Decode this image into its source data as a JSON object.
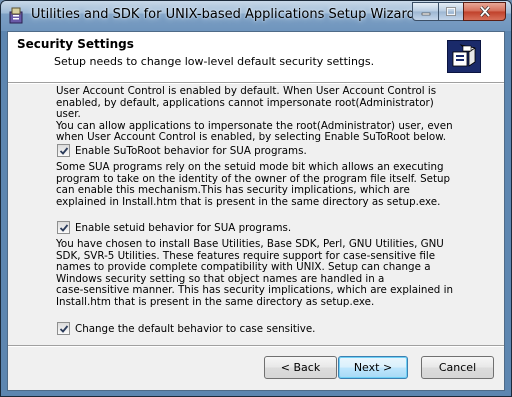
{
  "window": {
    "title": "Utilities and SDK for UNIX-based Applications Setup Wizard",
    "minimize_icon": "minimize-icon",
    "maximize_icon": "maximize-icon",
    "close_icon": "close-icon"
  },
  "header": {
    "title": "Security Settings",
    "subtitle": "Setup needs to change low-level default security settings.",
    "icon": "security-settings-icon"
  },
  "body": {
    "intro": "User Account Control is enabled by default. When User Account Control is\nenabled, by default, applications cannot impersonate root(Administrator) user.\nYou can allow applications to impersonate the root(Administrator) user, even\nwhen User Account Control is enabled, by selecting Enable SuToRoot below.",
    "options": [
      {
        "label": "Enable SuToRoot behavior for SUA programs.",
        "checked": true,
        "description": "Some SUA programs rely on the setuid mode bit which allows an executing\nprogram to take on the identity of the owner of the program file itself. Setup\ncan enable this mechanism.This has security implications, which are\nexplained in Install.htm that is present in the same directory as setup.exe."
      },
      {
        "label": "Enable setuid behavior for SUA programs.",
        "checked": true,
        "description": "You have chosen to install Base Utilities, Base SDK, Perl, GNU Utilities, GNU\nSDK, SVR-5 Utilities. These features require support for case-sensitive file\nnames to provide complete compatibility with UNIX. Setup can change a\nWindows security setting so that object names are handled in a\ncase-sensitive manner. This has security implications, which are explained in\nInstall.htm that is present in the same directory as setup.exe."
      },
      {
        "label": "Change the default behavior to case sensitive.",
        "checked": true
      }
    ]
  },
  "footer": {
    "back_label": "< Back",
    "next_label": "Next >",
    "cancel_label": "Cancel"
  }
}
